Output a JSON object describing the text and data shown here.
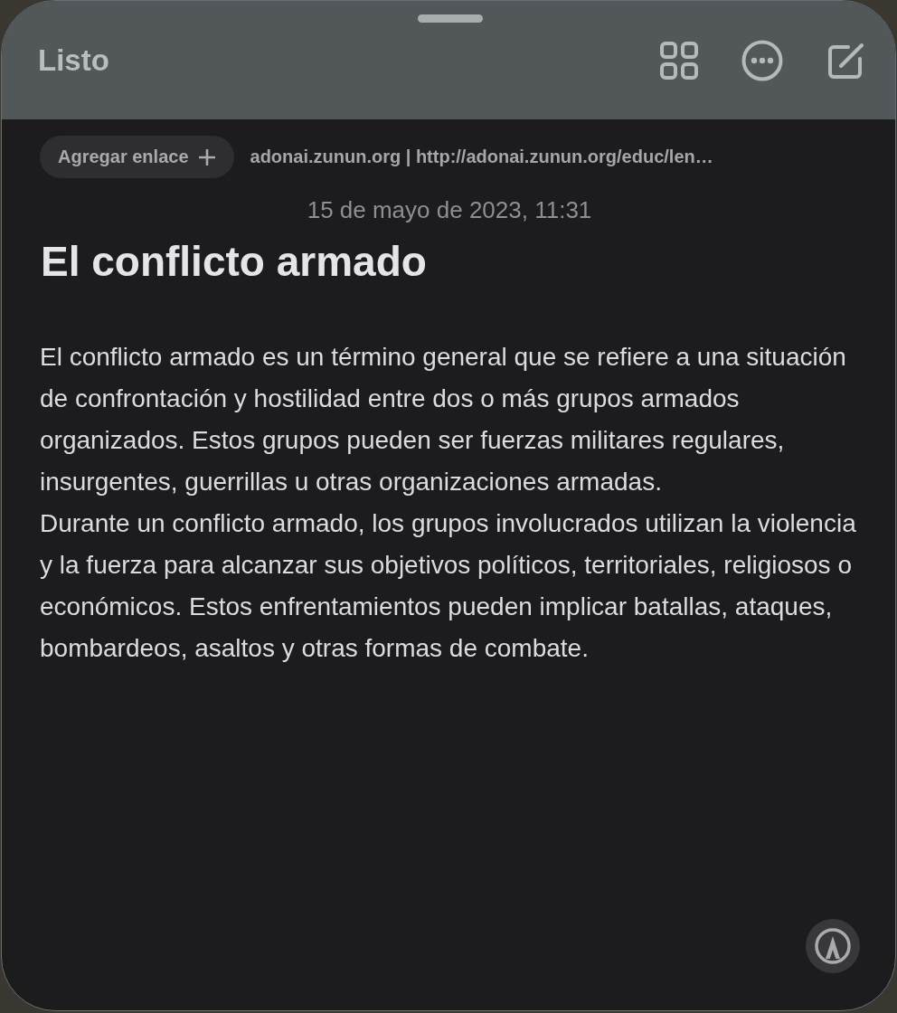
{
  "toolbar": {
    "done_label": "Listo"
  },
  "link_bar": {
    "add_link_label": "Agregar enlace",
    "link_text": "adonai.zunun.org | http://adonai.zunun.org/educ/len…"
  },
  "note": {
    "date": "15 de mayo de 2023, 11:31",
    "title": "El conflicto armado",
    "paragraphs": [
      "El conflicto armado es un término general que se refiere a una situación de confrontación y hostilidad entre dos o más grupos armados organizados. Estos grupos pueden ser fuerzas militares regulares, insurgentes, guerrillas u otras organizaciones armadas.",
      "Durante un conflicto armado, los grupos involucrados utilizan la violencia y la fuerza para alcanzar sus objetivos políticos, territoriales, religiosos o económicos. Estos enfrentamientos pueden implicar batallas, ataques, bombardeos, asaltos y otras formas de combate."
    ]
  }
}
